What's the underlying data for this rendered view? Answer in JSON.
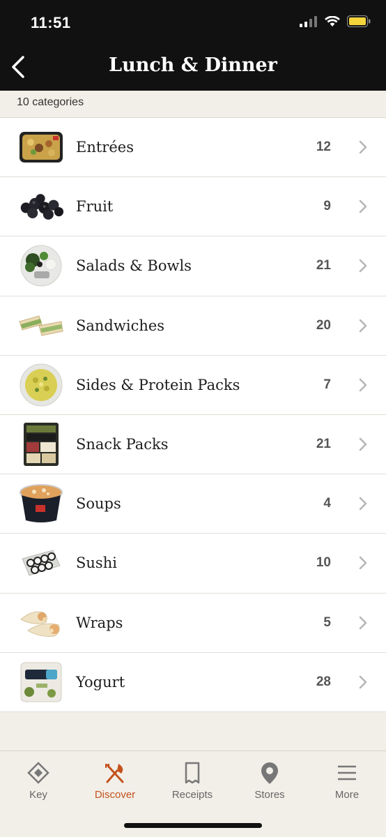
{
  "status_bar": {
    "time": "11:51"
  },
  "nav": {
    "title": "Lunch & Dinner",
    "back_icon": "chevron-left-icon"
  },
  "summary": {
    "count_label": "10 categories"
  },
  "categories": [
    {
      "label": "Entrées",
      "count": "12",
      "icon": "entree-tray-thumbnail"
    },
    {
      "label": "Fruit",
      "count": "9",
      "icon": "blackberries-thumbnail"
    },
    {
      "label": "Salads & Bowls",
      "count": "21",
      "icon": "salad-bowl-thumbnail"
    },
    {
      "label": "Sandwiches",
      "count": "20",
      "icon": "sandwich-thumbnail"
    },
    {
      "label": "Sides & Protein Packs",
      "count": "7",
      "icon": "side-salad-thumbnail"
    },
    {
      "label": "Snack Packs",
      "count": "21",
      "icon": "snack-pack-thumbnail"
    },
    {
      "label": "Soups",
      "count": "4",
      "icon": "soup-cup-thumbnail"
    },
    {
      "label": "Sushi",
      "count": "10",
      "icon": "sushi-tray-thumbnail"
    },
    {
      "label": "Wraps",
      "count": "5",
      "icon": "wraps-thumbnail"
    },
    {
      "label": "Yogurt",
      "count": "28",
      "icon": "yogurt-tub-thumbnail"
    }
  ],
  "tabs": [
    {
      "label": "Key",
      "icon": "diamond-key-icon",
      "active": false
    },
    {
      "label": "Discover",
      "icon": "fork-knife-icon",
      "active": true
    },
    {
      "label": "Receipts",
      "icon": "receipt-icon",
      "active": false
    },
    {
      "label": "Stores",
      "icon": "map-pin-icon",
      "active": false
    },
    {
      "label": "More",
      "icon": "hamburger-menu-icon",
      "active": false
    }
  ],
  "colors": {
    "header": "#111111",
    "accent": "#c3521d",
    "background": "#f2efe8"
  }
}
